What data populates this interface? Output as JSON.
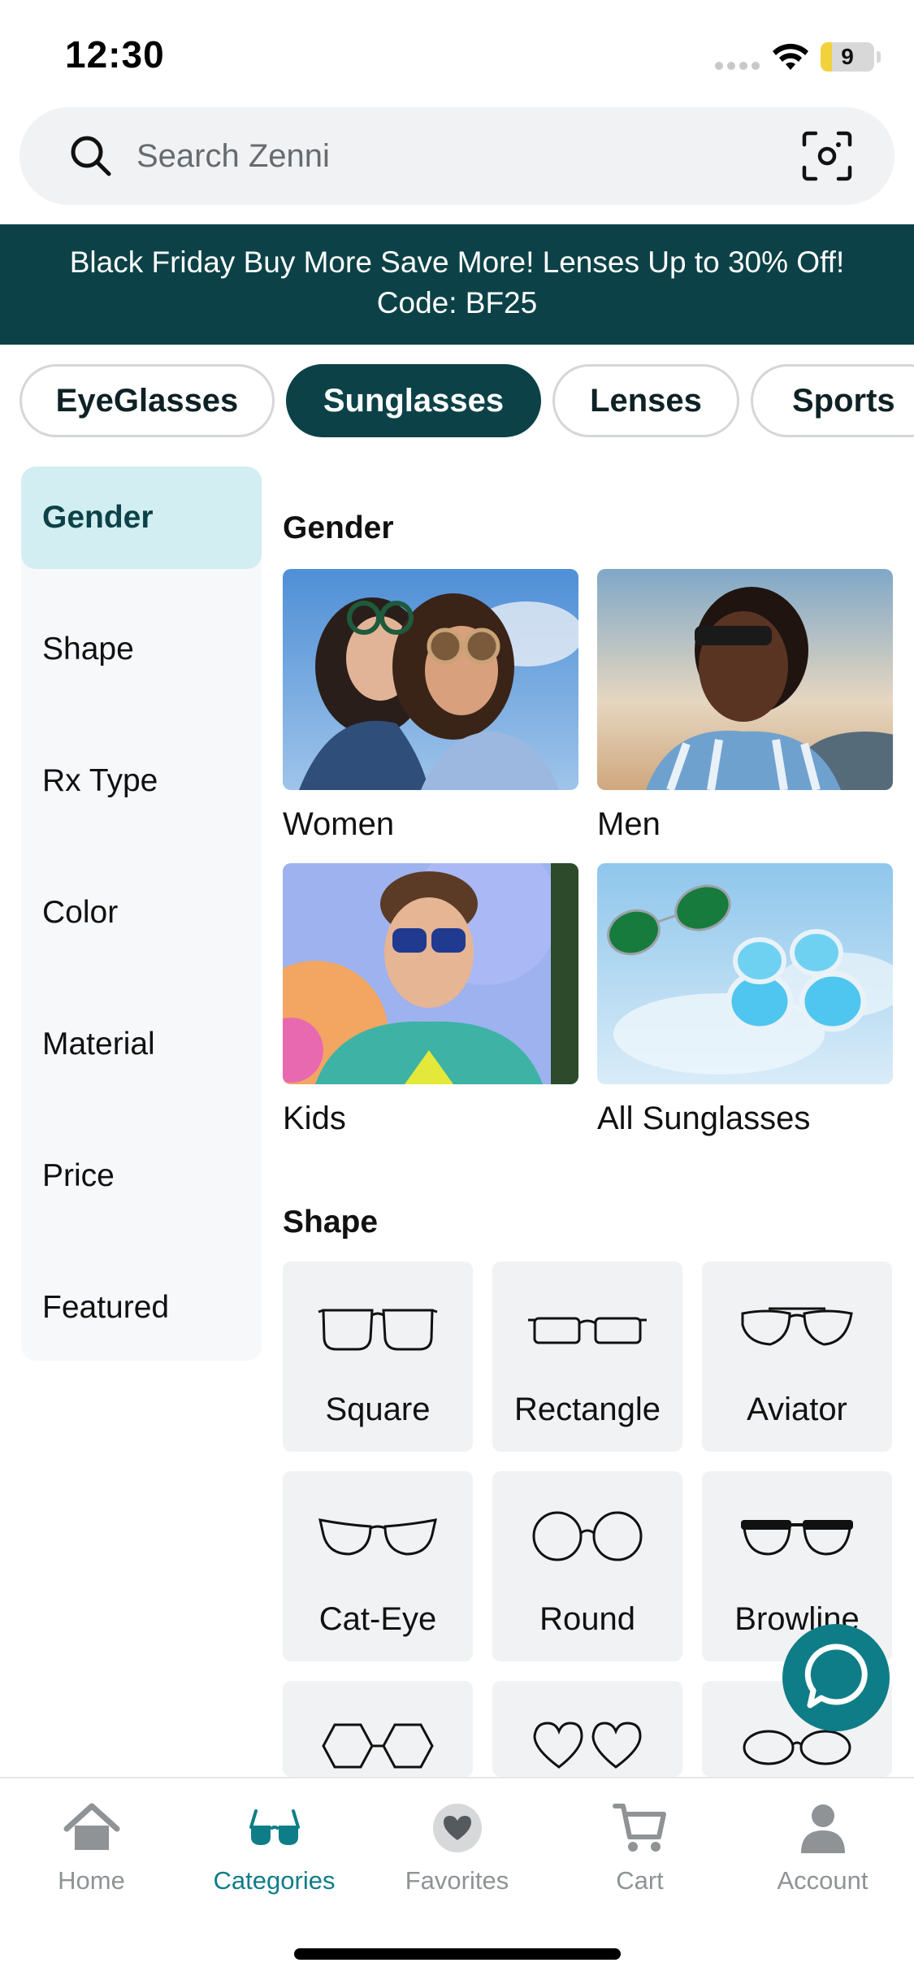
{
  "status_bar": {
    "time": "12:30",
    "battery": "9"
  },
  "search": {
    "placeholder": "Search Zenni"
  },
  "promo": {
    "line1": "Black Friday Buy More Save More! Lenses Up to 30% Off!",
    "line2": "Code: BF25"
  },
  "tabs": [
    {
      "label": "EyeGlasses",
      "active": false
    },
    {
      "label": "Sunglasses",
      "active": true
    },
    {
      "label": "Lenses",
      "active": false
    },
    {
      "label": "Sports",
      "active": false
    }
  ],
  "sidebar": {
    "items": [
      {
        "label": "Gender",
        "active": true
      },
      {
        "label": "Shape"
      },
      {
        "label": "Rx Type"
      },
      {
        "label": "Color"
      },
      {
        "label": "Material"
      },
      {
        "label": "Price"
      },
      {
        "label": "Featured"
      }
    ]
  },
  "gender_section": {
    "title": "Gender",
    "cards": [
      {
        "label": "Women"
      },
      {
        "label": "Men"
      },
      {
        "label": "Kids"
      },
      {
        "label": "All Sunglasses"
      }
    ]
  },
  "shape_section": {
    "title": "Shape",
    "tiles": [
      {
        "label": "Square"
      },
      {
        "label": "Rectangle"
      },
      {
        "label": "Aviator"
      },
      {
        "label": "Cat-Eye"
      },
      {
        "label": "Round"
      },
      {
        "label": "Browline"
      }
    ]
  },
  "bottom_nav": [
    {
      "label": "Home"
    },
    {
      "label": "Categories",
      "active": true
    },
    {
      "label": "Favorites"
    },
    {
      "label": "Cart"
    },
    {
      "label": "Account"
    }
  ],
  "colors": {
    "brand_dark": "#0c4247",
    "brand_teal": "#0f7d87",
    "sidebar_active": "#d2eef3"
  }
}
